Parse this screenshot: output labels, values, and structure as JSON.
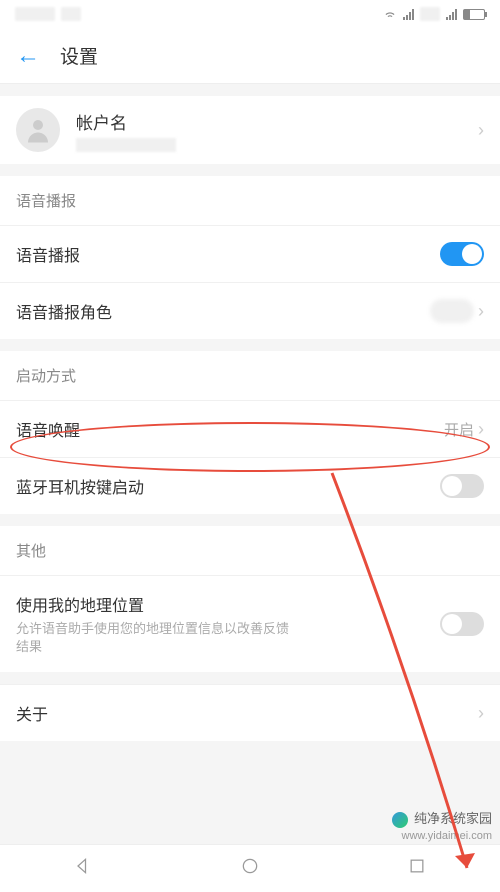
{
  "header": {
    "title": "设置"
  },
  "account": {
    "name_label": "帐户名"
  },
  "sections": {
    "voice_broadcast_header": "语音播报",
    "start_mode_header": "启动方式",
    "other_header": "其他"
  },
  "rows": {
    "voice_broadcast": {
      "label": "语音播报",
      "toggle": true
    },
    "voice_role": {
      "label": "语音播报角色"
    },
    "voice_wakeup": {
      "label": "语音唤醒",
      "value": "开启"
    },
    "bluetooth_start": {
      "label": "蓝牙耳机按键启动",
      "toggle": false
    },
    "location": {
      "label": "使用我的地理位置",
      "sublabel": "允许语音助手使用您的地理位置信息以改善反馈结果",
      "toggle": false
    },
    "about": {
      "label": "关于"
    }
  },
  "watermark": {
    "cn": "纯净系统家园",
    "url": "www.yidaimei.com"
  },
  "annotation": {
    "highlight_color": "#e74c3c"
  }
}
